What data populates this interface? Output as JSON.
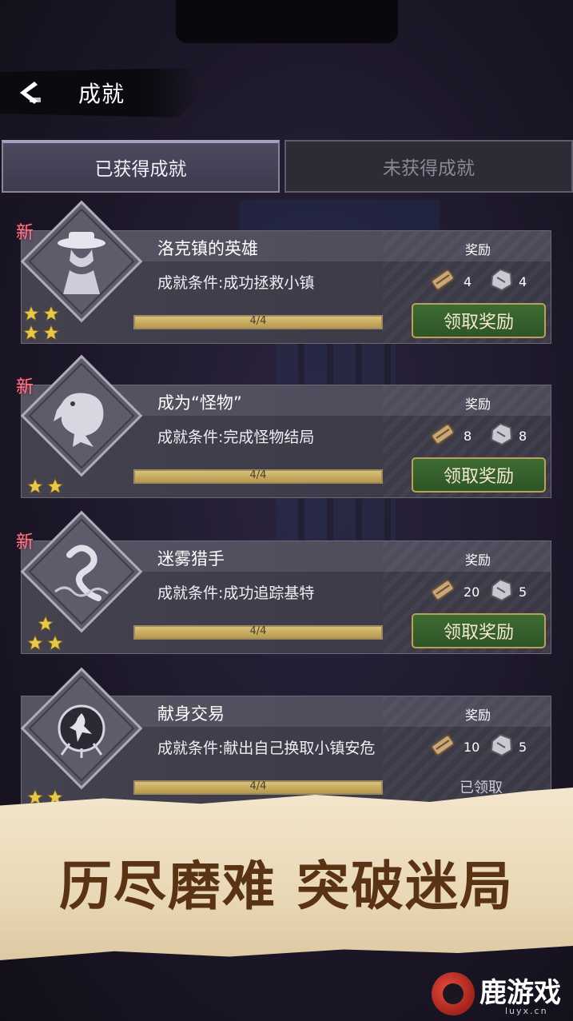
{
  "header": {
    "title": "成就"
  },
  "tabs": [
    {
      "label": "已获得成就",
      "active": true
    },
    {
      "label": "未获得成就",
      "active": false
    }
  ],
  "achievements": [
    {
      "new_label": "新",
      "title": "洛克镇的英雄",
      "reward_label": "奖励",
      "condition": "成就条件:成功拯救小镇",
      "progress": "4/4",
      "progress_fraction": 1.0,
      "reward_a": "4",
      "reward_b": "4",
      "stars": 4,
      "art": "detective-icon",
      "action_label": "领取奖励"
    },
    {
      "new_label": "新",
      "title": "成为“怪物”",
      "reward_label": "奖励",
      "condition": "成就条件:完成怪物结局",
      "progress": "4/4",
      "progress_fraction": 1.0,
      "reward_a": "8",
      "reward_b": "8",
      "stars": 2,
      "art": "monster-icon",
      "action_label": "领取奖励"
    },
    {
      "new_label": "新",
      "title": "迷雾猎手",
      "reward_label": "奖励",
      "condition": "成就条件:成功追踪基特",
      "progress": "4/4",
      "progress_fraction": 1.0,
      "reward_a": "20",
      "reward_b": "5",
      "stars": 3,
      "art": "serpent-icon",
      "action_label": "领取奖励"
    },
    {
      "new_label": "",
      "title": "献身交易",
      "reward_label": "奖励",
      "condition": "成就条件:献出自己换取小镇安危",
      "progress": "4/4",
      "progress_fraction": 1.0,
      "reward_a": "10",
      "reward_b": "5",
      "stars": 2,
      "art": "ritual-icon",
      "action_label": "已领取"
    }
  ],
  "banner": {
    "text": "历尽磨难 突破迷局"
  },
  "watermark": {
    "text": "鹿游戏",
    "url": "luyx.cn"
  },
  "colors": {
    "accent_green": "#2f5527",
    "gold": "#b9a15a",
    "new_badge": "#ff7b8e",
    "star": "#e6c94c"
  }
}
